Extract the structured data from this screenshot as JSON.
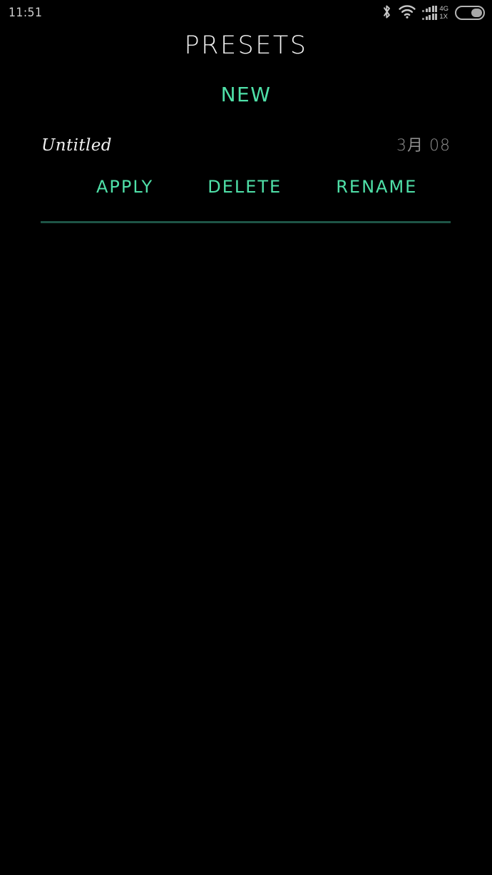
{
  "status_bar": {
    "time": "11:51",
    "icons": {
      "bluetooth": "bluetooth-icon",
      "wifi": "wifi-icon",
      "signal_primary_label": "4G",
      "signal_secondary_label": "1X",
      "battery": "battery-icon"
    }
  },
  "header": {
    "title": "PRESETS"
  },
  "actions": {
    "new_label": "NEW"
  },
  "presets": [
    {
      "name": "Untitled",
      "date": "3月 08",
      "apply_label": "APPLY",
      "delete_label": "DELETE",
      "rename_label": "RENAME"
    }
  ],
  "colors": {
    "background": "#000000",
    "accent_green": "#4fe0a8",
    "divider_green": "#1e5446",
    "primary_text": "#f0f0f0",
    "secondary_text": "#8e8e8e"
  }
}
